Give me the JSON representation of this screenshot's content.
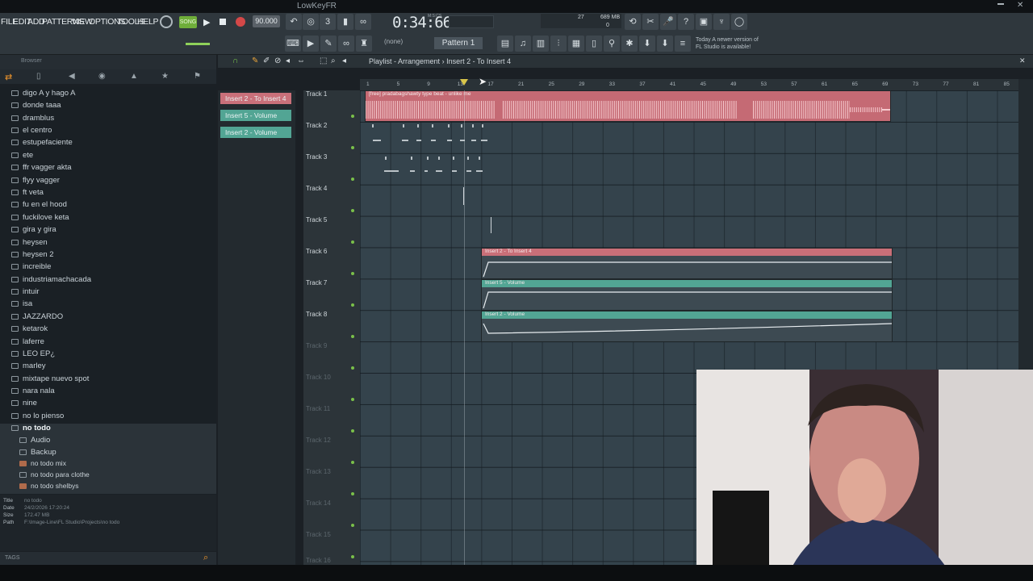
{
  "window": {
    "title": "LowKeyFR"
  },
  "menu": [
    "FILE",
    "EDIT",
    "ADD",
    "PATTERNS",
    "VIEW",
    "OPTIONS",
    "TOOLS",
    "HELP"
  ],
  "transport": {
    "mode": "SONG",
    "tempo": "90.000",
    "time": "0:34:66",
    "time_unit": "M:S:CS",
    "cpu": "27",
    "memory": "689 MB",
    "polyphony": "0"
  },
  "toolbar": {
    "pattern_label": "Pattern 1",
    "channel_none": "(none)",
    "hint_line1": "Today  A newer version of",
    "hint_line2": "FL Studio is available!"
  },
  "browser": {
    "title": "Browser",
    "folders": [
      "digo A y hago A",
      "donde taaa",
      "dramblus",
      "el centro",
      "estupefaciente",
      "ete",
      "ffr vagger akta",
      "flyy vagger",
      "ft veta",
      "fu en el hood",
      "fuckilove keta",
      "gira y gira",
      "heysen",
      "heysen 2",
      "increible",
      "industriamachacada",
      "intuir",
      "isa",
      "JAZZARDO",
      "ketarok",
      "laferre",
      "LEO EP¿",
      "marley",
      "mixtape nuevo spot",
      "nara nala",
      "nine",
      "no lo pienso",
      "no todo"
    ],
    "subfolders": [
      "Audio",
      "Backup"
    ],
    "files": [
      "no todo mix",
      "no todo para clothe",
      "no todo shelbys"
    ],
    "info": {
      "title_label": "Title",
      "title": "no todo",
      "date_label": "Date",
      "date": "24/2/2026 17:20:24",
      "size_label": "Size",
      "size": "172.47 MB",
      "path_label": "Path",
      "path": "F:\\Image-Line\\FL Studio\\Projects\\no todo"
    },
    "tags_label": "TAGS"
  },
  "playlist": {
    "title": "Playlist - Arrangement",
    "breadcrumb_sep": "›",
    "current": "Insert 2 - To Insert 4",
    "clip_sources": [
      "Insert 2 - To Insert 4",
      "Insert 5 - Volume",
      "Insert 2 - Volume"
    ],
    "tracks": [
      "Track 1",
      "Track 2",
      "Track 3",
      "Track 4",
      "Track 5",
      "Track 6",
      "Track 7",
      "Track 8",
      "Track 9",
      "Track 10",
      "Track 11",
      "Track 12",
      "Track 13",
      "Track 14",
      "Track 15",
      "Track 16"
    ],
    "ruler": [
      "1",
      "5",
      "9",
      "13",
      "17",
      "21",
      "25",
      "29",
      "33",
      "37",
      "41",
      "45",
      "49",
      "53",
      "57",
      "61",
      "65",
      "69",
      "73",
      "77",
      "81",
      "85"
    ],
    "clips": {
      "audio": "[free] pradabagshawty type beat - unlike me",
      "auto1": "Insert 2 - To Insert 4",
      "auto2": "Insert 5 - Volume",
      "auto3": "Insert 2 - Volume"
    }
  },
  "colors": {
    "audio_clip": "#d9737c",
    "auto_red": "#c96f78",
    "auto_teal": "#52a594",
    "accent_green": "#7ac04a"
  }
}
